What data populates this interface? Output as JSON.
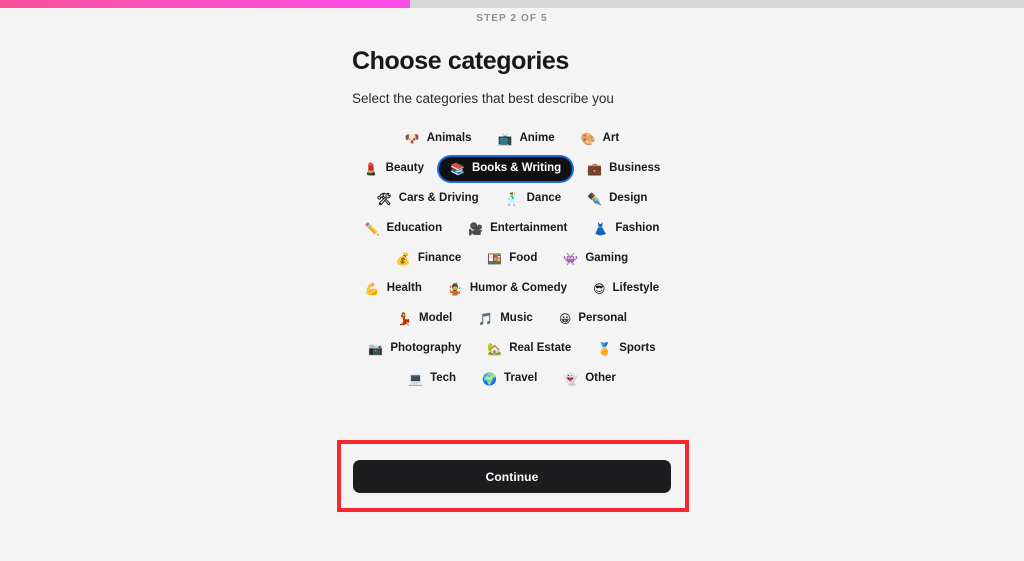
{
  "progress": {
    "percent": 40,
    "fill_start_color": "#f9539c",
    "fill_end_color": "#fb4ced",
    "track_color": "#d8d8d8"
  },
  "header": {
    "step_label": "STEP 2 OF 5",
    "title": "Choose categories",
    "subtitle": "Select the categories that best describe you"
  },
  "categories": [
    {
      "label": "Animals",
      "emoji": "🐶",
      "icon_name": "dog-face-icon",
      "selected": false
    },
    {
      "label": "Anime",
      "emoji": "📺",
      "icon_name": "television-icon",
      "selected": false
    },
    {
      "label": "Art",
      "emoji": "🎨",
      "icon_name": "artist-palette-icon",
      "selected": false
    },
    {
      "label": "Beauty",
      "emoji": "💄",
      "icon_name": "lipstick-icon",
      "selected": false
    },
    {
      "label": "Books & Writing",
      "emoji": "📚",
      "icon_name": "books-icon",
      "selected": true
    },
    {
      "label": "Business",
      "emoji": "💼",
      "icon_name": "briefcase-icon",
      "selected": false
    },
    {
      "label": "Cars & Driving",
      "emoji": "🛠",
      "icon_name": "steering-wheel-icon",
      "selected": false
    },
    {
      "label": "Dance",
      "emoji": "🕺",
      "icon_name": "dancer-icon",
      "selected": false
    },
    {
      "label": "Design",
      "emoji": "✒️",
      "icon_name": "pen-icon",
      "selected": false
    },
    {
      "label": "Education",
      "emoji": "✏️",
      "icon_name": "pencil-icon",
      "selected": false
    },
    {
      "label": "Entertainment",
      "emoji": "🎥",
      "icon_name": "movie-camera-icon",
      "selected": false
    },
    {
      "label": "Fashion",
      "emoji": "👗",
      "icon_name": "dress-icon",
      "selected": false
    },
    {
      "label": "Finance",
      "emoji": "💰",
      "icon_name": "money-bag-icon",
      "selected": false
    },
    {
      "label": "Food",
      "emoji": "🍱",
      "icon_name": "bento-box-icon",
      "selected": false
    },
    {
      "label": "Gaming",
      "emoji": "👾",
      "icon_name": "alien-monster-icon",
      "selected": false
    },
    {
      "label": "Health",
      "emoji": "💪",
      "icon_name": "flexed-biceps-icon",
      "selected": false
    },
    {
      "label": "Humor & Comedy",
      "emoji": "🤹",
      "icon_name": "juggling-person-icon",
      "selected": false
    },
    {
      "label": "Lifestyle",
      "emoji": "😎",
      "icon_name": "smiling-face-sunglasses-icon",
      "selected": false
    },
    {
      "label": "Model",
      "emoji": "💃",
      "icon_name": "dancing-woman-icon",
      "selected": false
    },
    {
      "label": "Music",
      "emoji": "🎵",
      "icon_name": "musical-note-icon",
      "selected": false
    },
    {
      "label": "Personal",
      "emoji": "😀",
      "icon_name": "grinning-face-icon",
      "selected": false
    },
    {
      "label": "Photography",
      "emoji": "📷",
      "icon_name": "camera-icon",
      "selected": false
    },
    {
      "label": "Real Estate",
      "emoji": "🏡",
      "icon_name": "house-with-garden-icon",
      "selected": false
    },
    {
      "label": "Sports",
      "emoji": "🏅",
      "icon_name": "sports-medal-icon",
      "selected": false
    },
    {
      "label": "Tech",
      "emoji": "💻",
      "icon_name": "laptop-icon",
      "selected": false
    },
    {
      "label": "Travel",
      "emoji": "🌍",
      "icon_name": "globe-icon",
      "selected": false
    },
    {
      "label": "Other",
      "emoji": "👻",
      "icon_name": "ghost-icon",
      "selected": false
    }
  ],
  "footer": {
    "continue_label": "Continue",
    "button_color": "#1d1d20",
    "highlight_color": "#f8262f"
  }
}
